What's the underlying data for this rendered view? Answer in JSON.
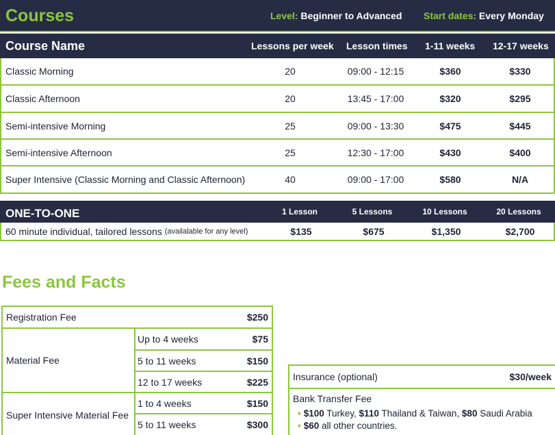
{
  "header": {
    "title": "Courses",
    "level_label": "Level:",
    "level_value": "Beginner to Advanced",
    "start_label": "Start dates:",
    "start_value": "Every Monday"
  },
  "courses": {
    "columns": {
      "name": "Course Name",
      "lessons_per_week": "Lessons per week",
      "lesson_times": "Lesson times",
      "weeks_1_11": "1-11 weeks",
      "weeks_12_17": "12-17 weeks"
    },
    "rows": [
      {
        "name": "Classic Morning",
        "lessons": "20",
        "times": "09:00 - 12:15",
        "p1": "$360",
        "p2": "$330"
      },
      {
        "name": "Classic Afternoon",
        "lessons": "20",
        "times": "13:45 - 17:00",
        "p1": "$320",
        "p2": "$295"
      },
      {
        "name": "Semi-intensive Morning",
        "lessons": "25",
        "times": "09:00 - 13:30",
        "p1": "$475",
        "p2": "$445"
      },
      {
        "name": "Semi-intensive Afternoon",
        "lessons": "25",
        "times": "12:30 - 17:00",
        "p1": "$430",
        "p2": "$400"
      },
      {
        "name": "Super Intensive (Classic Morning and Classic Afternoon)",
        "lessons": "40",
        "times": "09:00 - 17:00",
        "p1": "$580",
        "p2": "N/A"
      }
    ]
  },
  "one_to_one": {
    "title": "ONE-TO-ONE",
    "columns": [
      "1 Lesson",
      "5 Lessons",
      "10 Lessons",
      "20 Lessons"
    ],
    "description": "60 minute individual, tailored lessons",
    "note": "(availalable for any level)",
    "prices": [
      "$135",
      "$675",
      "$1,350",
      "$2,700"
    ]
  },
  "fees": {
    "title": "Fees and Facts",
    "registration": {
      "label": "Registration Fee",
      "price": "$250"
    },
    "material": {
      "label": "Material Fee",
      "items": [
        {
          "duration": "Up to 4 weeks",
          "price": "$75"
        },
        {
          "duration": "5 to 11 weeks",
          "price": "$150"
        },
        {
          "duration": "12 to 17 weeks",
          "price": "$225"
        }
      ]
    },
    "super_material": {
      "label": "Super Intensive Material Fee",
      "items": [
        {
          "duration": "1 to 4 weeks",
          "price": "$150"
        },
        {
          "duration": "5 to 11 weeks",
          "price": "$300"
        }
      ]
    },
    "insurance": {
      "label": "Insurance (optional)",
      "price": "$30/week"
    },
    "bank_transfer": {
      "label": "Bank Transfer Fee",
      "line1": {
        "a_price": "$100",
        "a_place": " Turkey, ",
        "b_price": "$110",
        "b_place": " Thailand & Taiwan, ",
        "c_price": "$80",
        "c_place": " Saudi Arabia"
      },
      "line2": {
        "price": "$60",
        "text": " all other countries."
      }
    }
  },
  "colors": {
    "navy": "#272c45",
    "green": "#8cc63f"
  }
}
